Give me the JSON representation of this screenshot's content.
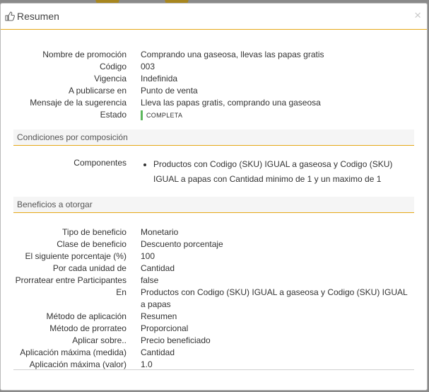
{
  "modal": {
    "title": "Resumen",
    "close_symbol": "×"
  },
  "general": {
    "rows": [
      {
        "label": "Nombre de promoción",
        "value": "Comprando una gaseosa, llevas las papas gratis"
      },
      {
        "label": "Código",
        "value": "003"
      },
      {
        "label": "Vigencia",
        "value": "Indefinida"
      },
      {
        "label": "A publicarse en",
        "value": "Punto de venta"
      },
      {
        "label": "Mensaje de la sugerencia",
        "value": "Lleva las papas gratis, comprando una gaseosa"
      }
    ],
    "status_label": "Estado",
    "status_value": "COMPLETA",
    "status_color": "#5cb85c"
  },
  "conditions": {
    "section_title": "Condiciones por composición",
    "components_label": "Componentes",
    "components_items": [
      "Productos con Codigo (SKU) IGUAL a gaseosa y Codigo (SKU) IGUAL a papas con Cantidad minimo de 1 y un maximo de 1"
    ]
  },
  "benefits": {
    "section_title": "Beneficios a otorgar",
    "rows": [
      {
        "label": "Tipo de beneficio",
        "value": "Monetario"
      },
      {
        "label": "Clase de beneficio",
        "value": "Descuento porcentaje"
      },
      {
        "label": "El siguiente porcentaje (%)",
        "value": "100"
      },
      {
        "label": "Por cada unidad de",
        "value": "Cantidad"
      },
      {
        "label": "Prorratear entre Participantes",
        "value": "false"
      },
      {
        "label": "En",
        "value": "Productos con Codigo (SKU) IGUAL a gaseosa y Codigo (SKU) IGUAL a papas"
      },
      {
        "label": "Método de aplicación",
        "value": "Resumen"
      },
      {
        "label": "Método de prorrateo",
        "value": "Proporcional"
      },
      {
        "label": "Aplicar sobre..",
        "value": "Precio beneficiado"
      },
      {
        "label": "Aplicación máxima (medida)",
        "value": "Cantidad"
      },
      {
        "label": "Aplicación máxima (valor)",
        "value": "1.0"
      }
    ]
  },
  "theme": {
    "accent": "#e6a817"
  }
}
